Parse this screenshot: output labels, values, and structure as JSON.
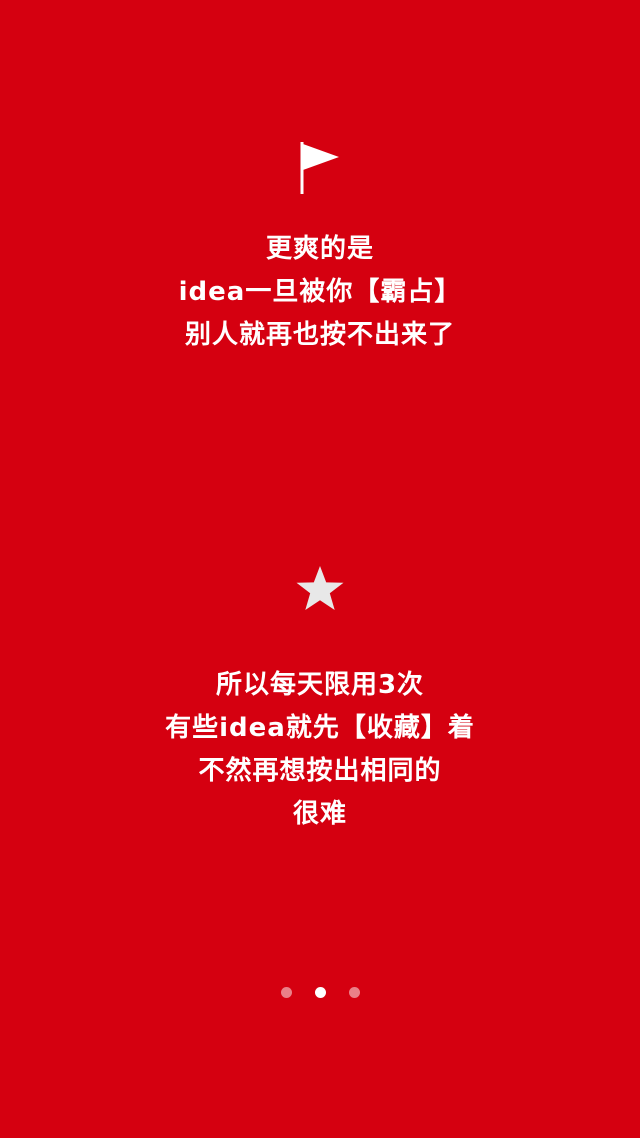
{
  "slides": {
    "block1": {
      "icon": "flag-icon",
      "lines": [
        "更爽的是",
        "idea一旦被你【霸占】",
        "别人就再也按不出来了"
      ]
    },
    "block2": {
      "icon": "star-icon",
      "lines": [
        "所以每天限用3次",
        "有些idea就先【收藏】着",
        "不然再想按出相同的",
        "很难"
      ]
    }
  },
  "pagination": {
    "count": 3,
    "active_index": 1
  },
  "colors": {
    "background": "#d50010",
    "text": "#ffffff",
    "star": "#e8e8e8"
  }
}
